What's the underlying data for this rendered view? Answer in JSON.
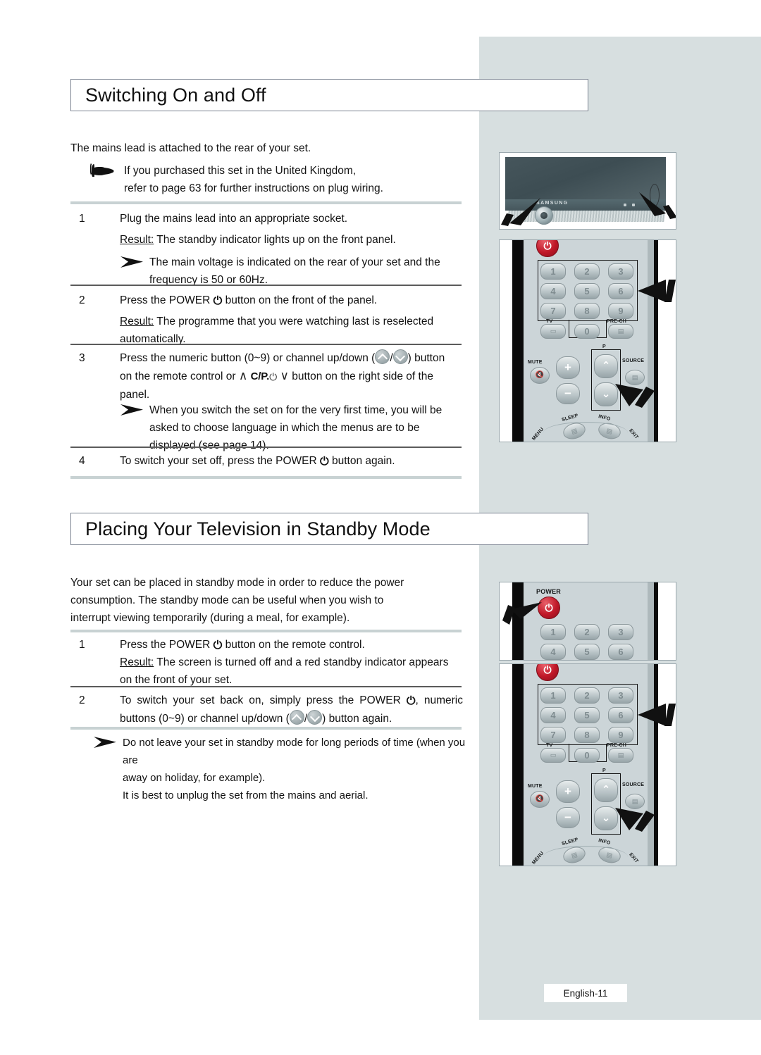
{
  "page": {
    "footer_label": "English-11",
    "sidebar_color": "#d7dfe0"
  },
  "sections": [
    {
      "id": "switching",
      "title": "Switching On and Off",
      "intro": "The mains lead is attached to the rear of your set.",
      "hand_note_line1": "If you purchased this set in the United Kingdom,",
      "hand_note_line2": "refer to page 63 for further instructions on plug wiring.",
      "steps": [
        {
          "num": "1",
          "text": "Plug the mains lead into an appropriate socket.",
          "result_label": "Result:",
          "result_text": "The standby indicator lights up on the front panel.",
          "note": "The main voltage is indicated on the rear of your set and the frequency is 50 or 60Hz."
        },
        {
          "num": "2",
          "text_before_icon": "Press the POWER",
          "text_after_icon": "button on the front of the panel.",
          "result_label": "Result:",
          "result_text": "The programme that you were watching last is reselected automatically."
        },
        {
          "num": "3",
          "t1": "Press the numeric button (0~9) or channel up/down (",
          "t2": "/",
          "t3": ") button",
          "t4": "on the remote control or",
          "cp_label": "C/P.",
          "t5": "button on the right side of the",
          "t6": "panel.",
          "note": "When you switch the set on for the very first time, you will be asked to choose language in which the menus are to be displayed (see page 14)."
        },
        {
          "num": "4",
          "text_before_icon": "To switch your set off, press the POWER",
          "text_after_icon": "button again."
        }
      ]
    },
    {
      "id": "standby",
      "title": "Placing Your Television in Standby Mode",
      "intro_line1": "Your set can be placed in standby mode in order to reduce the power",
      "intro_line2": "consumption. The standby mode can be useful when you wish to",
      "intro_line3": "interrupt viewing temporarily (during a meal, for example).",
      "steps": [
        {
          "num": "1",
          "text_before_icon": "Press the POWER",
          "text_after_icon": "button on the remote control.",
          "result_label": "Result:",
          "result_text": "The screen is turned off and a red standby indicator appears on the front of your set."
        },
        {
          "num": "2",
          "t1": "To switch your set back on, simply press the POWER",
          "t2": ", numeric",
          "t3": "buttons (0~9) or channel up/down (",
          "t4": "/",
          "t5": ") button again."
        }
      ],
      "note_line1": "Do not leave your set in standby mode for long periods of time (when you are",
      "note_line2": "away on holiday, for example).",
      "note_line3": "It is best to unplug the set from the mains and aerial."
    }
  ],
  "illustrations": {
    "tv": {
      "name": "samsung-flat-panel-tv",
      "brand_logo": "SAMSUNG"
    },
    "remote_full_top": {
      "name": "remote-control-full",
      "numeric_keys": [
        "1",
        "2",
        "3",
        "4",
        "5",
        "6",
        "7",
        "8",
        "9"
      ],
      "zero_key": "0",
      "tv_label": "TV",
      "prech_label": "PRE-CH",
      "mute_label": "MUTE",
      "source_label": "SOURCE",
      "p_label": "P",
      "sleep_label": "SLEEP",
      "info_label": "INFO",
      "exit_label": "EXIT",
      "menu_label": "MENU",
      "vol_plus": "+",
      "vol_minus": "−"
    },
    "remote_power_detail": {
      "name": "remote-control-power-detail",
      "power_label": "POWER",
      "numeric_keys": [
        "1",
        "2",
        "3",
        "4",
        "5",
        "6"
      ]
    },
    "remote_full_bottom": {
      "name": "remote-control-full",
      "numeric_keys": [
        "1",
        "2",
        "3",
        "4",
        "5",
        "6",
        "7",
        "8",
        "9"
      ],
      "zero_key": "0",
      "tv_label": "TV",
      "prech_label": "PRE-CH",
      "mute_label": "MUTE",
      "source_label": "SOURCE",
      "p_label": "P",
      "sleep_label": "SLEEP",
      "info_label": "INFO",
      "exit_label": "EXIT",
      "menu_label": "MENU",
      "vol_plus": "+",
      "vol_minus": "−"
    }
  },
  "icons": {
    "power_glyph": "⏻",
    "hand_glyph": "☛",
    "chevron_up": "∧",
    "chevron_down": "∨"
  }
}
